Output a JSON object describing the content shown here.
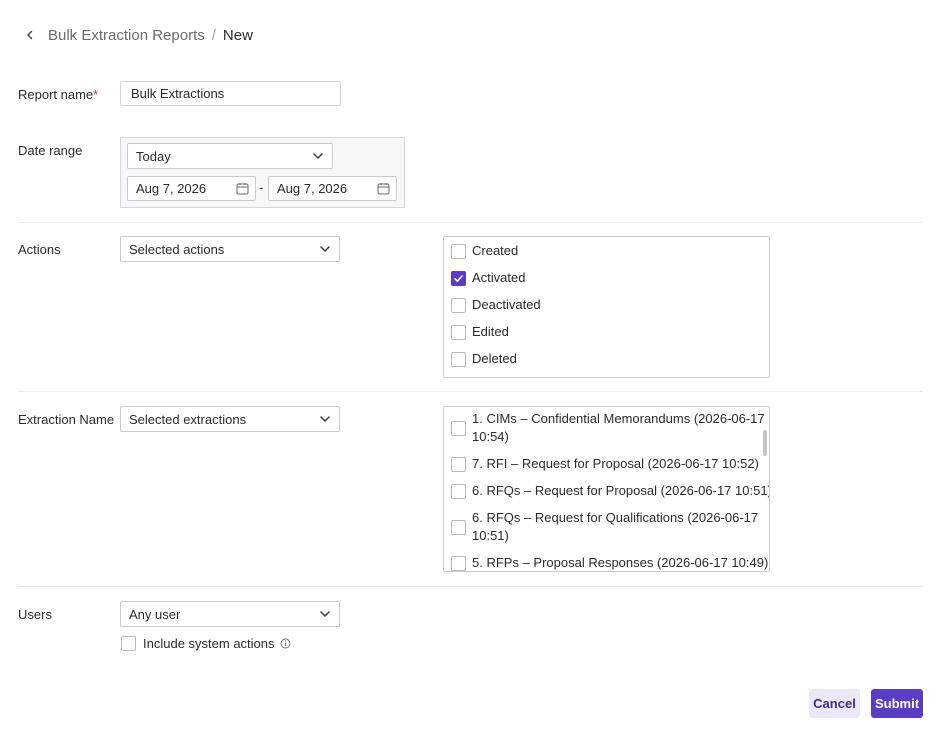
{
  "breadcrumb": {
    "parent": "Bulk Extraction Reports",
    "separator": "/",
    "current": "New"
  },
  "report_name": {
    "label": "Report name",
    "required_mark": "*",
    "value": "Bulk Extractions"
  },
  "date_range": {
    "label": "Date range",
    "preset": "Today",
    "start": "Aug 7, 2026",
    "dash": "-",
    "end": "Aug 7, 2026"
  },
  "actions": {
    "label": "Actions",
    "selected": "Selected actions",
    "options": [
      {
        "label": "Created",
        "checked": false
      },
      {
        "label": "Activated",
        "checked": true
      },
      {
        "label": "Deactivated",
        "checked": false
      },
      {
        "label": "Edited",
        "checked": false
      },
      {
        "label": "Deleted",
        "checked": false
      }
    ]
  },
  "extraction": {
    "label": "Extraction Name",
    "selected": "Selected extractions",
    "options": [
      {
        "line1": "1. CIMs – Confidential Memorandums (2026-06-17",
        "line2": "10:54)",
        "checked": false
      },
      {
        "line1": "7. RFI – Request for Proposal (2026-06-17 10:52)",
        "line2": "",
        "checked": false
      },
      {
        "line1": "6. RFQs – Request for Proposal (2026-06-17 10:51)",
        "line2": "",
        "checked": false
      },
      {
        "line1": "6. RFQs – Request for Qualifications (2026-06-17",
        "line2": "10:51)",
        "checked": false
      },
      {
        "line1": "5. RFPs – Proposal Responses (2026-06-17 10:49)",
        "line2": "",
        "checked": false
      }
    ]
  },
  "users": {
    "label": "Users",
    "selected": "Any user",
    "system_actions_label": "Include system actions",
    "system_actions_checked": false
  },
  "buttons": {
    "cancel": "Cancel",
    "submit": "Submit"
  },
  "colors": {
    "accent": "#5b3cc4",
    "required": "#e0283c",
    "cancel_bg": "#ece8f8"
  }
}
